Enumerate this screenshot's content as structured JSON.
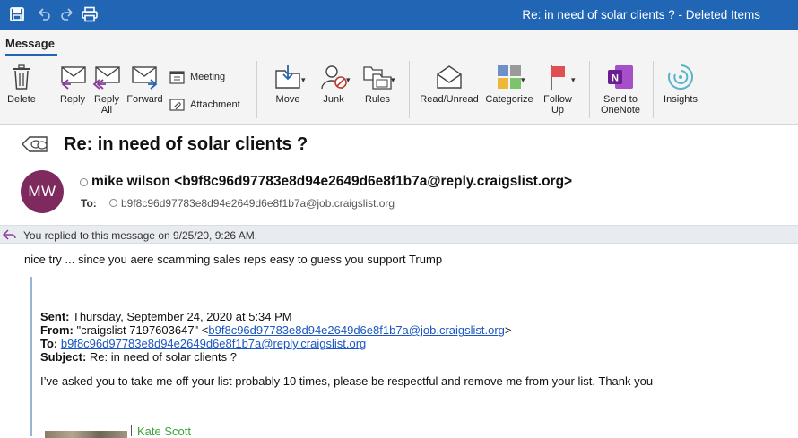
{
  "window": {
    "title": "Re: in need of solar clients ? - Deleted Items",
    "quick_access": [
      "save-icon",
      "undo-icon",
      "redo-icon",
      "print-icon"
    ]
  },
  "tabs": {
    "active": "Message"
  },
  "ribbon": {
    "delete": "Delete",
    "reply": "Reply",
    "reply_all_1": "Reply",
    "reply_all_2": "All",
    "forward": "Forward",
    "meeting": "Meeting",
    "attachment": "Attachment",
    "move": "Move",
    "junk": "Junk",
    "rules": "Rules",
    "read_unread": "Read/Unread",
    "categorize": "Categorize",
    "follow_up_1": "Follow",
    "follow_up_2": "Up",
    "send_onenote_1": "Send to",
    "send_onenote_2": "OneNote",
    "insights": "Insights"
  },
  "message": {
    "subject": "Re: in need of solar clients ?",
    "avatar_initials": "MW",
    "avatar_color": "#7e2a5e",
    "sender": "mike wilson <b9f8c96d97783e8d94e2649d6e8f1b7a@reply.craigslist.org>",
    "to_label": "To:",
    "to_address": "b9f8c96d97783e8d94e2649d6e8f1b7a@job.craigslist.org",
    "replied_notice": "You replied to this message on 9/25/20, 9:26 AM.",
    "body": "nice try ... since you aere scamming sales reps easy to guess you support Trump"
  },
  "quoted": {
    "sent_label": "Sent:",
    "sent_value": "Thursday, September 24, 2020 at 5:34 PM",
    "from_label": "From:",
    "from_prefix": "\"craigslist 7197603647\" <",
    "from_link": "b9f8c96d97783e8d94e2649d6e8f1b7a@job.craigslist.org",
    "from_suffix": ">",
    "to_label": "To:",
    "to_link": "b9f8c96d97783e8d94e2649d6e8f1b7a@reply.craigslist.org",
    "subject_label": "Subject:",
    "subject_value": "Re: in need of solar clients ?",
    "body": "I’ve asked you to take me off your list probably 10 times, please be respectful and remove me from your list. Thank you",
    "signature_name": "Kate Scott"
  },
  "colors": {
    "titlebar": "#2166b5",
    "link": "#1a56c4",
    "signature": "#3aa33a"
  }
}
